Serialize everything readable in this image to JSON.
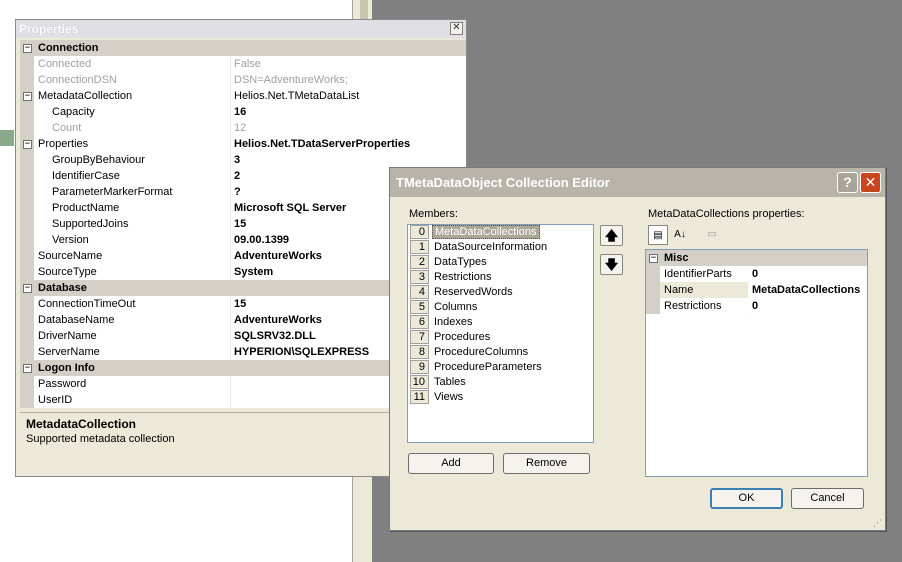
{
  "properties_panel": {
    "title": "Properties",
    "close_glyph": "✕",
    "rows": [
      {
        "kind": "cat",
        "name": "Connection"
      },
      {
        "kind": "prop",
        "name": "Connected",
        "value": "False",
        "disabled": true
      },
      {
        "kind": "prop",
        "name": "ConnectionDSN",
        "value": "DSN=AdventureWorks;",
        "disabled": true
      },
      {
        "kind": "exp",
        "name": "MetadataCollection",
        "value": "Helios.Net.TMetaDataList"
      },
      {
        "kind": "sub",
        "name": "Capacity",
        "value": "16",
        "bold": true
      },
      {
        "kind": "sub",
        "name": "Count",
        "value": "12",
        "disabled": true
      },
      {
        "kind": "exp",
        "name": "Properties",
        "value": "Helios.Net.TDataServerProperties",
        "bold": true
      },
      {
        "kind": "sub",
        "name": "GroupByBehaviour",
        "value": "3",
        "bold": true
      },
      {
        "kind": "sub",
        "name": "IdentifierCase",
        "value": "2",
        "bold": true
      },
      {
        "kind": "sub",
        "name": "ParameterMarkerFormat",
        "value": "?",
        "bold": true
      },
      {
        "kind": "sub",
        "name": "ProductName",
        "value": "Microsoft SQL Server",
        "bold": true
      },
      {
        "kind": "sub",
        "name": "SupportedJoins",
        "value": "15",
        "bold": true
      },
      {
        "kind": "sub",
        "name": "Version",
        "value": "09.00.1399",
        "bold": true
      },
      {
        "kind": "prop",
        "name": "SourceName",
        "value": "AdventureWorks",
        "bold": true
      },
      {
        "kind": "prop",
        "name": "SourceType",
        "value": "System",
        "bold": true
      },
      {
        "kind": "cat",
        "name": "Database"
      },
      {
        "kind": "prop",
        "name": "ConnectionTimeOut",
        "value": "15",
        "bold": true
      },
      {
        "kind": "prop",
        "name": "DatabaseName",
        "value": "AdventureWorks",
        "bold": true
      },
      {
        "kind": "prop",
        "name": "DriverName",
        "value": "SQLSRV32.DLL",
        "bold": true
      },
      {
        "kind": "prop",
        "name": "ServerName",
        "value": "HYPERION\\SQLEXPRESS",
        "bold": true
      },
      {
        "kind": "cat",
        "name": "Logon Info"
      },
      {
        "kind": "prop",
        "name": "Password",
        "value": ""
      },
      {
        "kind": "prop",
        "name": "UserID",
        "value": ""
      }
    ],
    "description": {
      "title": "MetadataCollection",
      "text": "Supported metadata collection"
    }
  },
  "editor": {
    "title": "TMetaDataObject Collection Editor",
    "help_glyph": "?",
    "close_glyph": "✕",
    "members_label": "Members:",
    "properties_label": "MetaDataCollections properties:",
    "members": [
      {
        "index": "0",
        "name": "MetaDataCollections",
        "selected": true
      },
      {
        "index": "1",
        "name": "DataSourceInformation"
      },
      {
        "index": "2",
        "name": "DataTypes"
      },
      {
        "index": "3",
        "name": "Restrictions"
      },
      {
        "index": "4",
        "name": "ReservedWords"
      },
      {
        "index": "5",
        "name": "Columns"
      },
      {
        "index": "6",
        "name": "Indexes"
      },
      {
        "index": "7",
        "name": "Procedures"
      },
      {
        "index": "8",
        "name": "ProcedureColumns"
      },
      {
        "index": "9",
        "name": "ProcedureParameters"
      },
      {
        "index": "10",
        "name": "Tables"
      },
      {
        "index": "11",
        "name": "Views"
      }
    ],
    "up_glyph": "🡅",
    "down_glyph": "🡇",
    "add_label": "Add",
    "remove_label": "Remove",
    "ok_label": "OK",
    "cancel_label": "Cancel",
    "toolbar_icons": [
      "categorized-icon",
      "alphabetical-icon",
      "property-pages-icon"
    ],
    "prop_rows": [
      {
        "kind": "cat",
        "name": "Misc"
      },
      {
        "kind": "prop",
        "name": "IdentifierParts",
        "value": "0"
      },
      {
        "kind": "prop",
        "name": "Name",
        "value": "MetaDataCollections",
        "selected": true
      },
      {
        "kind": "prop",
        "name": "Restrictions",
        "value": "0"
      }
    ],
    "colors": {
      "title_bar": "#b8b4a9",
      "close_button": "#c8451e",
      "selection": "#aca899"
    }
  }
}
